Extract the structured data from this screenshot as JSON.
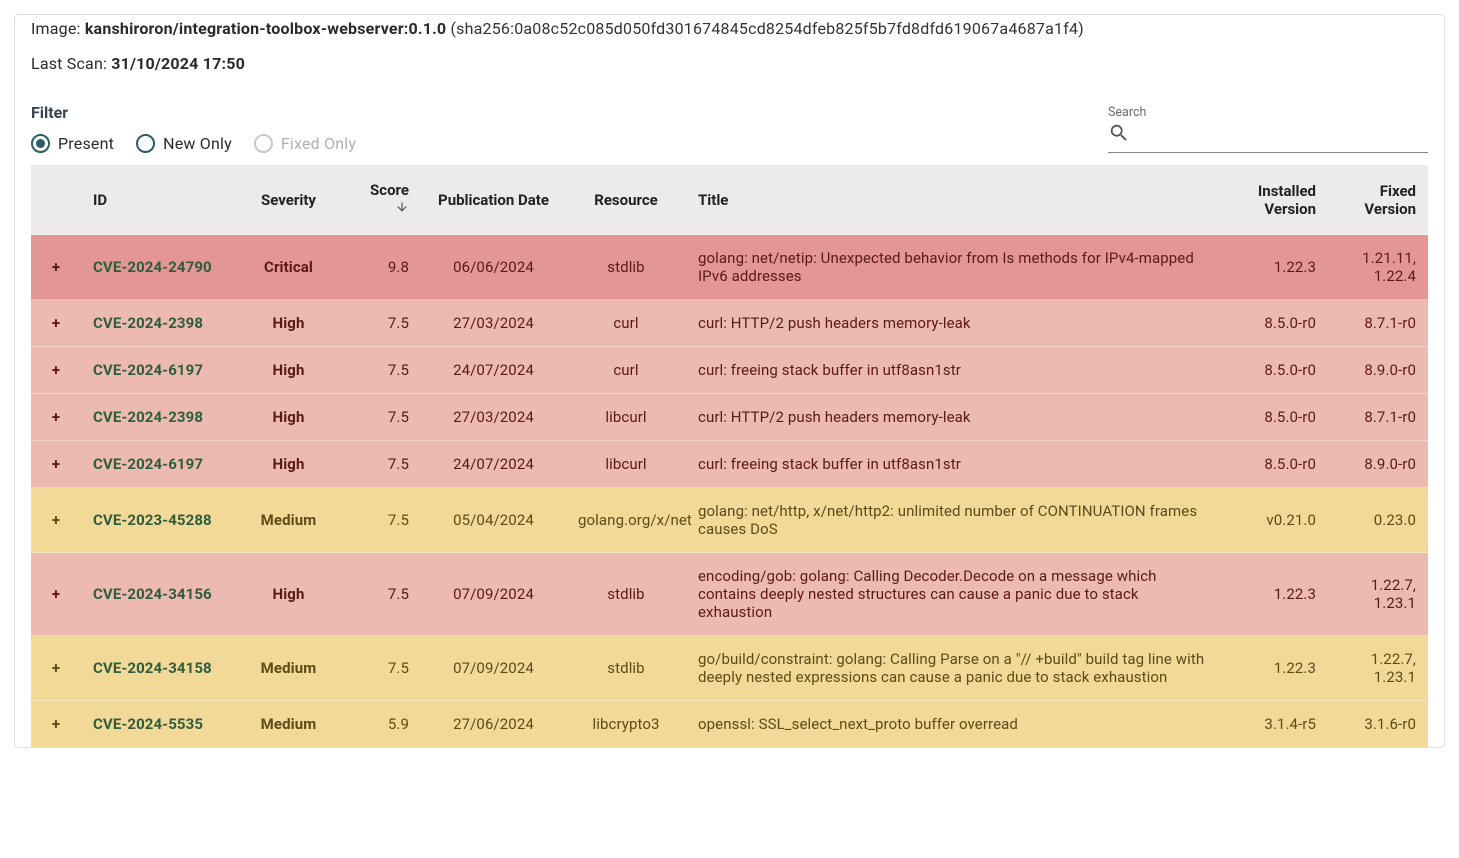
{
  "header": {
    "image_label": "Image: ",
    "image_name": "kanshiroron/integration-toolbox-webserver:0.1.0",
    "image_hash": " (sha256:0a08c52c085d050fd301674845cd8254dfeb825f5b7fd8dfd619067a4687a1f4)",
    "last_scan_label": "Last Scan: ",
    "last_scan_value": "31/10/2024 17:50"
  },
  "filter": {
    "title": "Filter",
    "options": {
      "present": "Present",
      "new_only": "New Only",
      "fixed_only": "Fixed Only"
    },
    "selected": "present"
  },
  "search": {
    "label": "Search",
    "value": ""
  },
  "columns": {
    "id": "ID",
    "severity": "Severity",
    "score": "Score",
    "pub_date": "Publication Date",
    "resource": "Resource",
    "title": "Title",
    "installed": "Installed Version",
    "fixed": "Fixed Version"
  },
  "sort": {
    "column": "score",
    "direction": "desc"
  },
  "rows": [
    {
      "id": "CVE-2024-24790",
      "severity": "Critical",
      "score": "9.8",
      "pub_date": "06/06/2024",
      "resource": "stdlib",
      "title": "golang: net/netip: Unexpected behavior from Is methods for IPv4-mapped IPv6 addresses",
      "installed": "1.22.3",
      "fixed": "1.21.11, 1.22.4"
    },
    {
      "id": "CVE-2024-2398",
      "severity": "High",
      "score": "7.5",
      "pub_date": "27/03/2024",
      "resource": "curl",
      "title": "curl: HTTP/2 push headers memory-leak",
      "installed": "8.5.0-r0",
      "fixed": "8.7.1-r0"
    },
    {
      "id": "CVE-2024-6197",
      "severity": "High",
      "score": "7.5",
      "pub_date": "24/07/2024",
      "resource": "curl",
      "title": "curl: freeing stack buffer in utf8asn1str",
      "installed": "8.5.0-r0",
      "fixed": "8.9.0-r0"
    },
    {
      "id": "CVE-2024-2398",
      "severity": "High",
      "score": "7.5",
      "pub_date": "27/03/2024",
      "resource": "libcurl",
      "title": "curl: HTTP/2 push headers memory-leak",
      "installed": "8.5.0-r0",
      "fixed": "8.7.1-r0"
    },
    {
      "id": "CVE-2024-6197",
      "severity": "High",
      "score": "7.5",
      "pub_date": "24/07/2024",
      "resource": "libcurl",
      "title": "curl: freeing stack buffer in utf8asn1str",
      "installed": "8.5.0-r0",
      "fixed": "8.9.0-r0"
    },
    {
      "id": "CVE-2023-45288",
      "severity": "Medium",
      "score": "7.5",
      "pub_date": "05/04/2024",
      "resource": "golang.org/x/net",
      "title": "golang: net/http, x/net/http2: unlimited number of CONTINUATION frames causes DoS",
      "installed": "v0.21.0",
      "fixed": "0.23.0"
    },
    {
      "id": "CVE-2024-34156",
      "severity": "High",
      "score": "7.5",
      "pub_date": "07/09/2024",
      "resource": "stdlib",
      "title": "encoding/gob: golang: Calling Decoder.Decode on a message which contains deeply nested structures can cause a panic due to stack exhaustion",
      "installed": "1.22.3",
      "fixed": "1.22.7, 1.23.1"
    },
    {
      "id": "CVE-2024-34158",
      "severity": "Medium",
      "score": "7.5",
      "pub_date": "07/09/2024",
      "resource": "stdlib",
      "title": "go/build/constraint: golang: Calling Parse on a \"// +build\" build tag line with deeply nested expressions can cause a panic due to stack exhaustion",
      "installed": "1.22.3",
      "fixed": "1.22.7, 1.23.1"
    },
    {
      "id": "CVE-2024-5535",
      "severity": "Medium",
      "score": "5.9",
      "pub_date": "27/06/2024",
      "resource": "libcrypto3",
      "title": "openssl: SSL_select_next_proto buffer overread",
      "installed": "3.1.4-r5",
      "fixed": "3.1.6-r0"
    }
  ],
  "icons": {
    "expand": "+"
  }
}
